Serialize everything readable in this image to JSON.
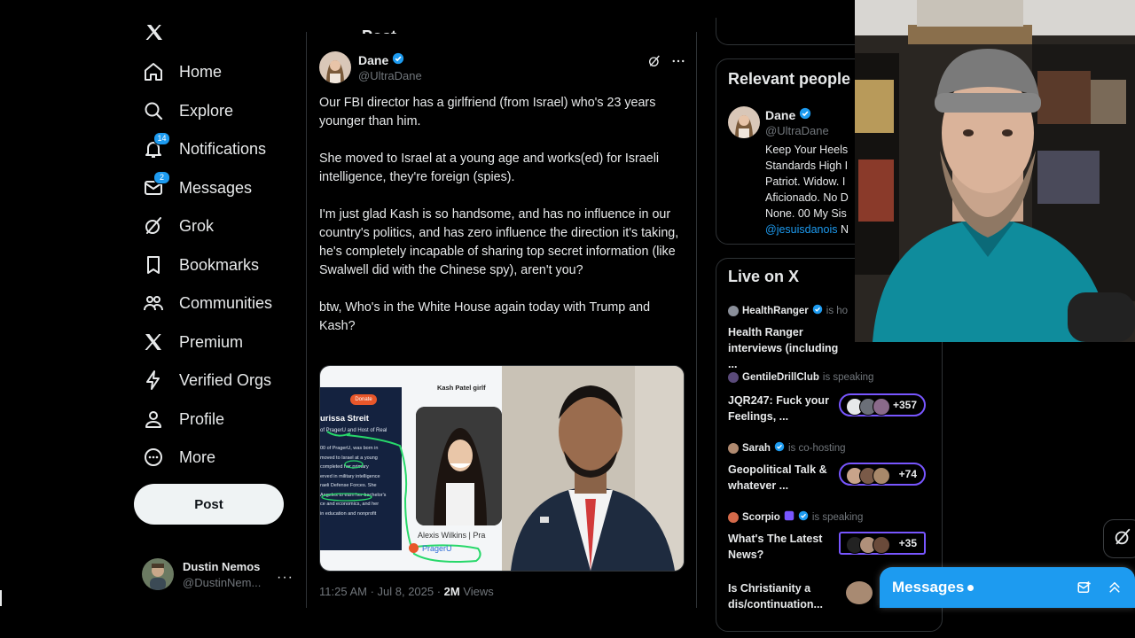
{
  "colors": {
    "accent": "#1d9bf0",
    "background": "#000000",
    "text": "#e7e9ea",
    "muted": "#71767b",
    "spaces_ring": "#7856ff"
  },
  "nav": {
    "items": [
      {
        "label": "Home",
        "icon": "home-icon"
      },
      {
        "label": "Explore",
        "icon": "search-icon"
      },
      {
        "label": "Notifications",
        "icon": "bell-icon",
        "badge": "14"
      },
      {
        "label": "Messages",
        "icon": "envelope-icon",
        "badge": "2"
      },
      {
        "label": "Grok",
        "icon": "grok-icon"
      },
      {
        "label": "Bookmarks",
        "icon": "bookmark-icon"
      },
      {
        "label": "Communities",
        "icon": "communities-icon"
      },
      {
        "label": "Premium",
        "icon": "x-logo-icon"
      },
      {
        "label": "Verified Orgs",
        "icon": "lightning-icon"
      },
      {
        "label": "Profile",
        "icon": "person-icon"
      },
      {
        "label": "More",
        "icon": "more-circle-icon"
      }
    ],
    "post_button": "Post",
    "account": {
      "name": "Dustin Nemos",
      "handle": "@DustinNem..."
    },
    "more_dots": "···"
  },
  "post": {
    "header_fragment": "Post",
    "author": {
      "name": "Dane",
      "handle": "@UltraDane"
    },
    "paragraphs": [
      "Our FBI director has a girlfriend (from Israel) who's 23 years younger than him.",
      "She moved to Israel at a young age and works(ed) for Israeli intelligence, they're foreign (spies).",
      "I'm just glad Kash is so handsome, and has no influence in our country's politics, and has zero influence the direction it's taking, he's completely incapable of sharing top secret information (like Swalwell did with the Chinese spy), aren't you?",
      "btw, Who's in the White House again today with Trump and Kash?"
    ],
    "media_left": {
      "header": "Kash Patel girlf",
      "button": "Donate",
      "name": "urissa Streit",
      "line2": "of PragerU and Host of Real",
      "bio": [
        "00 of PragerU, was born in",
        "moved to Israel at a young",
        "completed her primary",
        "erved in military intelligence",
        "raeli Defense Forces. She",
        "Angeles to earn her bachelor's",
        "ce and economics, and her",
        "in education and nonprofit"
      ],
      "caption": "Alexis Wilkins | Pra",
      "tag": "PragerU"
    },
    "time": "11:25 AM · Jul 8, 2025 · ",
    "views_count": "2M",
    "views_label": " Views"
  },
  "relevant": {
    "title": "Relevant people",
    "person": {
      "name": "Dane",
      "handle": "@UltraDane"
    },
    "bio_lines": [
      "Keep Your Heels",
      "Standards High I",
      "Patriot. Widow. I",
      "Aficionado. No D",
      "None. 00 My Sis"
    ],
    "bio_link": "@jesuisdanois",
    "bio_tail": " N"
  },
  "live": {
    "title": "Live on X",
    "spaces": [
      {
        "host": "HealthRanger",
        "status": "is ho",
        "title": "Health Ranger interviews (including ...",
        "count": "",
        "verified": true
      },
      {
        "host": "GentileDrillClub",
        "status": "is speaking",
        "title": "JQR247: Fuck your Feelings, ...",
        "count": "+357",
        "verified": false
      },
      {
        "host": "Sarah",
        "status": "is co-hosting",
        "title": "Geopolitical Talk & whatever ...",
        "count": "+74",
        "verified": true
      },
      {
        "host": "Scorpio",
        "status": "is speaking",
        "title": "What's The Latest News?",
        "count": "+35",
        "verified": true
      },
      {
        "host": "",
        "status": "",
        "title": "Is Christianity a dis/continuation...",
        "count": "",
        "verified": false
      }
    ]
  },
  "messages_bar": {
    "title": "Messages"
  }
}
